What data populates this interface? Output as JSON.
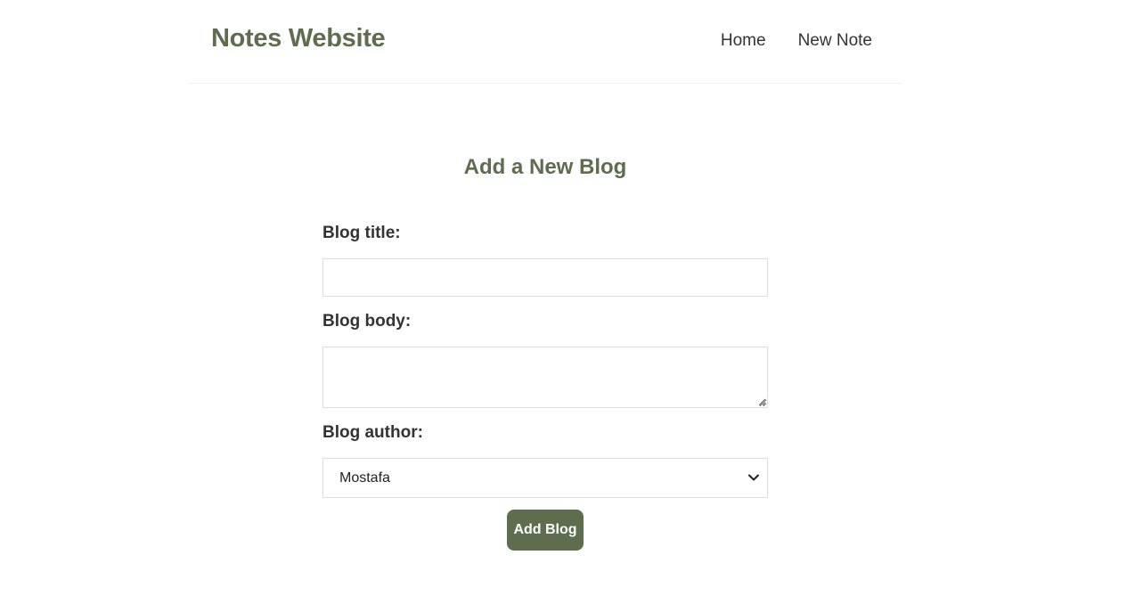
{
  "navbar": {
    "brand": "Notes Website",
    "links": [
      {
        "label": "Home"
      },
      {
        "label": "New Note"
      }
    ]
  },
  "form": {
    "heading": "Add a New Blog",
    "title_label": "Blog title:",
    "title_value": "",
    "body_label": "Blog body:",
    "body_value": "",
    "author_label": "Blog author:",
    "author_selected": "Mostafa",
    "submit_label": "Add Blog"
  },
  "colors": {
    "accent": "#5e6d4d",
    "text": "#333333",
    "border": "#dddddd"
  },
  "icons": {
    "select_arrow": "chevron-down-icon",
    "textarea_grip": "resize-grip-icon"
  }
}
